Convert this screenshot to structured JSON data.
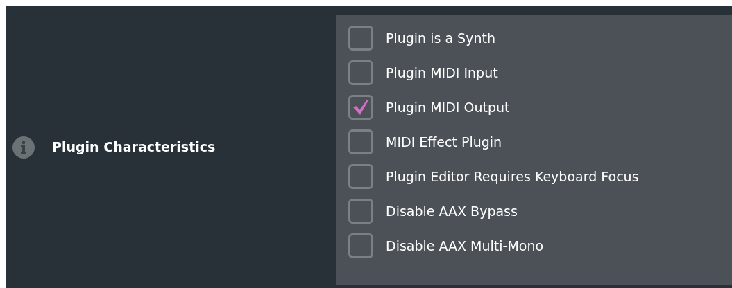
{
  "property": {
    "label": "Plugin Characteristics"
  },
  "options": [
    {
      "label": "Plugin is a Synth",
      "checked": false
    },
    {
      "label": "Plugin MIDI Input",
      "checked": false
    },
    {
      "label": "Plugin MIDI Output",
      "checked": true
    },
    {
      "label": "MIDI Effect Plugin",
      "checked": false
    },
    {
      "label": "Plugin Editor Requires Keyboard Focus",
      "checked": false
    },
    {
      "label": "Disable AAX Bypass",
      "checked": false
    },
    {
      "label": "Disable AAX Multi-Mono",
      "checked": false
    }
  ]
}
